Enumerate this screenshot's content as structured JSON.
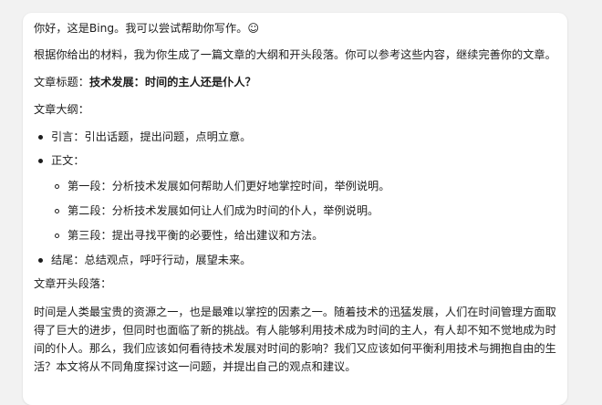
{
  "message": {
    "greeting": "你好，这是Bing。我可以尝试帮助你写作。☺",
    "intro": "根据你给出的材料，我为你生成了一篇文章的大纲和开头段落。你可以参考这些内容，继续完善你的文章。",
    "title_label": "文章标题：",
    "title_value": "技术发展：时间的主人还是仆人？",
    "outline_label": "文章大纲：",
    "outline": {
      "intro_item": "引言：引出话题，提出问题，点明立意。",
      "body_item": "正文：",
      "body_sub": [
        "第一段：分析技术发展如何帮助人们更好地掌控时间，举例说明。",
        "第二段：分析技术发展如何让人们成为时间的仆人，举例说明。",
        "第三段：提出寻找平衡的必要性，给出建议和方法。"
      ],
      "conclusion_item": "结尾：总结观点，呼吁行动，展望未来。"
    },
    "opening_label": "文章开头段落：",
    "opening_paragraph": "时间是人类最宝贵的资源之一，也是最难以掌控的因素之一。随着技术的迅猛发展，人们在时间管理方面取得了巨大的进步，但同时也面临了新的挑战。有人能够利用技术成为时间的主人，有人却不知不觉地成为时间的仆人。那么，我们应该如何看待技术发展对时间的影响？我们又应该如何平衡利用技术与拥抱自由的生活？本文将从不同角度探讨这一问题，并提出自己的观点和建议。"
  }
}
